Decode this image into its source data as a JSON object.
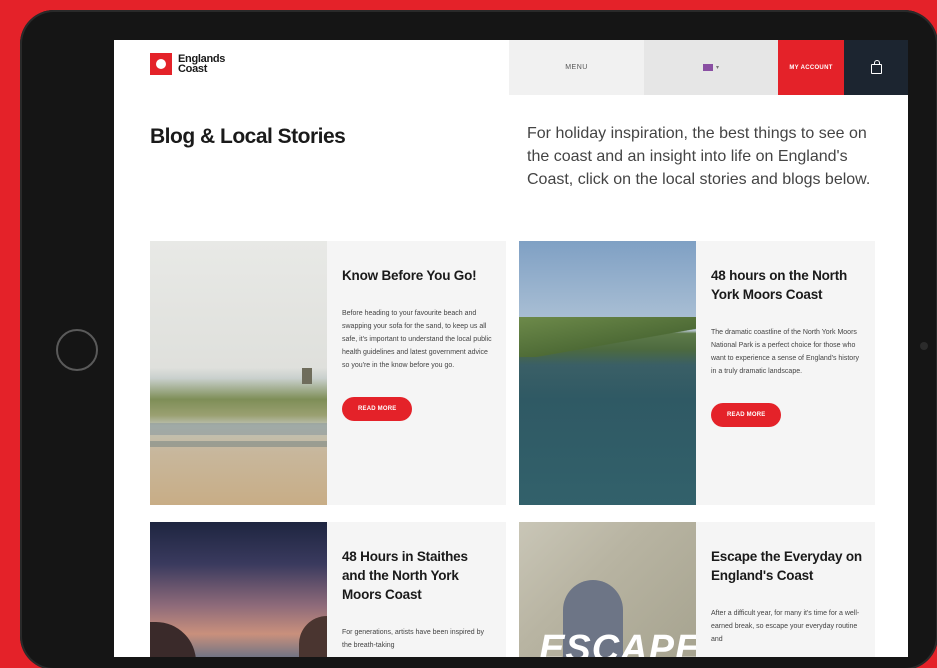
{
  "header": {
    "logo_text": "Englands Coast",
    "menu_label": "MENU",
    "account_label": "MY ACCOUNT"
  },
  "page": {
    "title": "Blog & Local Stories",
    "intro": "For holiday inspiration, the best things to see on the coast and an insight into life on England's Coast, click on the local stories and blogs below."
  },
  "cards": [
    {
      "title": "Know Before You Go!",
      "text": "Before heading to your favourite beach and swapping your sofa for the sand, to keep us all safe, it's important to understand the local public health guidelines and latest government advice so you're in the know before you go.",
      "button": "READ MORE"
    },
    {
      "title": "48 hours on the North York Moors Coast",
      "text": "The dramatic coastline of the North York Moors National Park is a perfect choice for those who want to experience a sense of England's history in a truly dramatic landscape.",
      "button": "READ MORE"
    },
    {
      "title": "48 Hours in Staithes and the North York Moors Coast",
      "text": "For generations, artists have been inspired by the breath-taking"
    },
    {
      "title": "Escape the Everyday on England's Coast",
      "text": "After a difficult year, for many it's time for a well-earned break, so escape your everyday routine and",
      "image_text": "ESCAPE"
    }
  ],
  "colors": {
    "brand_red": "#e42229",
    "nav_dark": "#1c2530"
  },
  "icons": [
    "logo-mark-icon",
    "flag-icon",
    "chevron-down-icon",
    "shopping-bag-icon",
    "home-button-icon"
  ]
}
